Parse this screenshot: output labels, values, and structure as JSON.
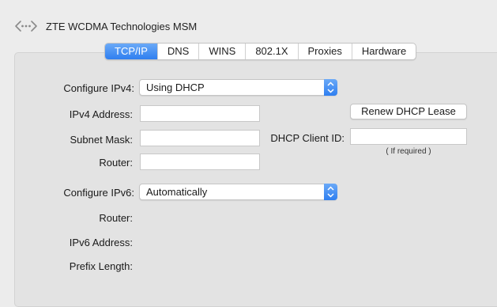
{
  "header": {
    "icon": "network-service-icon",
    "title": "ZTE WCDMA Technologies MSM"
  },
  "tabs": [
    {
      "label": "TCP/IP",
      "active": true
    },
    {
      "label": "DNS",
      "active": false
    },
    {
      "label": "WINS",
      "active": false
    },
    {
      "label": "802.1X",
      "active": false
    },
    {
      "label": "Proxies",
      "active": false
    },
    {
      "label": "Hardware",
      "active": false
    }
  ],
  "ipv4": {
    "configure_label": "Configure IPv4:",
    "configure_value": "Using DHCP",
    "address_label": "IPv4 Address:",
    "address_value": "",
    "subnet_label": "Subnet Mask:",
    "subnet_value": "",
    "router_label": "Router:",
    "router_value": ""
  },
  "dhcp": {
    "renew_label": "Renew DHCP Lease",
    "client_id_label": "DHCP Client ID:",
    "client_id_value": "",
    "client_id_note": "( If required )"
  },
  "ipv6": {
    "configure_label": "Configure IPv6:",
    "configure_value": "Automatically",
    "router_label": "Router:",
    "address_label": "IPv6 Address:",
    "prefix_label": "Prefix Length:"
  },
  "colors": {
    "accent": "#2f7ff0",
    "background": "#ececec",
    "panel": "#e3e3e3"
  }
}
